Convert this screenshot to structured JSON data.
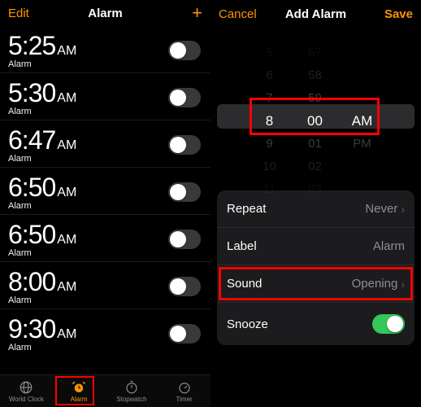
{
  "left": {
    "edit": "Edit",
    "title": "Alarm",
    "alarms": [
      {
        "time": "5:25",
        "ampm": "AM",
        "label": "Alarm"
      },
      {
        "time": "5:30",
        "ampm": "AM",
        "label": "Alarm"
      },
      {
        "time": "6:47",
        "ampm": "AM",
        "label": "Alarm"
      },
      {
        "time": "6:50",
        "ampm": "AM",
        "label": "Alarm"
      },
      {
        "time": "6:50",
        "ampm": "AM",
        "label": "Alarm"
      },
      {
        "time": "8:00",
        "ampm": "AM",
        "label": "Alarm"
      },
      {
        "time": "9:30",
        "ampm": "AM",
        "label": "Alarm"
      }
    ],
    "tabs": {
      "world_clock": "World Clock",
      "alarm": "Alarm",
      "stopwatch": "Stopwatch",
      "timer": "Timer"
    }
  },
  "right": {
    "cancel": "Cancel",
    "title": "Add Alarm",
    "save": "Save",
    "picker": {
      "hours": [
        "5",
        "6",
        "7",
        "8",
        "9",
        "10",
        "11"
      ],
      "minutes": [
        "57",
        "58",
        "59",
        "00",
        "01",
        "02",
        "03"
      ],
      "ampm": [
        "",
        "",
        "",
        "AM",
        "PM",
        "",
        ""
      ],
      "selected_index": 3
    },
    "settings": {
      "repeat_label": "Repeat",
      "repeat_value": "Never",
      "label_label": "Label",
      "label_value": "Alarm",
      "sound_label": "Sound",
      "sound_value": "Opening",
      "snooze_label": "Snooze",
      "snooze_on": true
    }
  }
}
